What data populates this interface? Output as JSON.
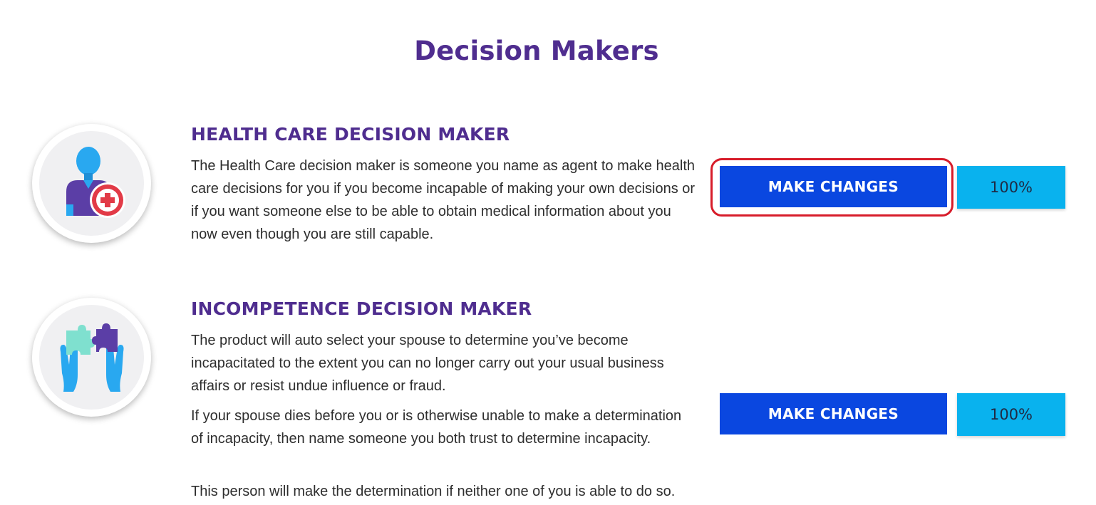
{
  "page": {
    "title": "Decision Makers"
  },
  "sections": [
    {
      "heading": "HEALTH CARE DECISION MAKER",
      "icon": "health-care-agent-icon",
      "paragraphs": [
        "The Health Care decision maker is someone you name as agent to make health care decisions for you if you become incapable of making your own decisions or if you want someone else to be able to obtain medical information about you now even though you are still capable."
      ],
      "button_label": "MAKE CHANGES",
      "progress": "100%",
      "highlighted": true
    },
    {
      "heading": "INCOMPETENCE DECISION MAKER",
      "icon": "puzzle-hands-icon",
      "paragraphs": [
        "The product will auto select your spouse to determine you’ve become incapacitated to the extent you can no longer carry out your usual business affairs or resist undue influence or fraud.",
        "If your spouse dies before you or is otherwise unable to make a determination of incapacity, then name someone you both trust to determine incapacity.",
        "This person will make the determination if neither one of you is able to do so."
      ],
      "button_label": "MAKE CHANGES",
      "progress": "100%",
      "highlighted": false
    }
  ],
  "colors": {
    "heading_purple": "#4f2d8f",
    "button_blue": "#0a47e0",
    "progress_cyan": "#09b2ee",
    "highlight_red": "#d71c2a"
  }
}
